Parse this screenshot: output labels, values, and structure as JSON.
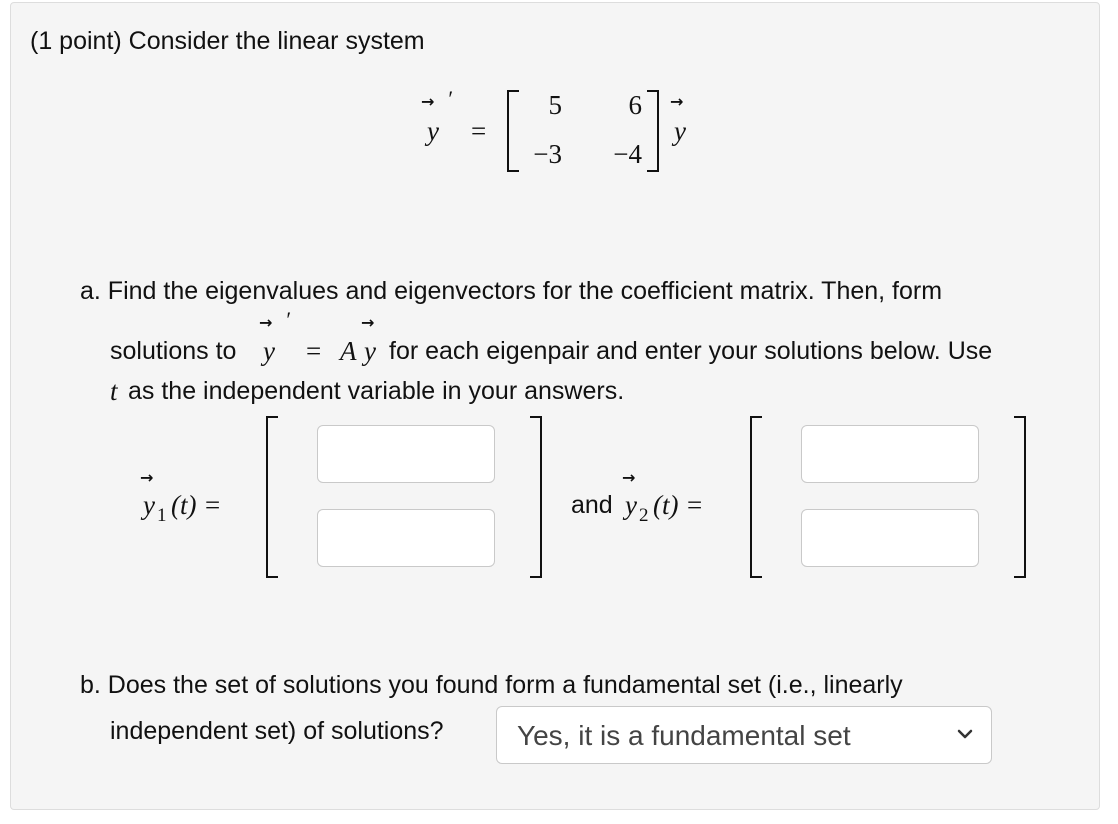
{
  "problem": {
    "intro": "(1 point) Consider the linear system",
    "system": {
      "lhs_var": "y",
      "equals": "=",
      "matrix": [
        [
          "5",
          "6"
        ],
        [
          "−3",
          "−4"
        ]
      ],
      "rhs_var": "y"
    },
    "part_a": {
      "line1": "a. Find the eigenvalues and eigenvectors for the coefficient matrix. Then, form",
      "line2_start": "solutions to",
      "eq_var": "y",
      "eq_equals": "=",
      "eq_rhs_A": "A",
      "eq_rhs_y": "y",
      "line2_end": "for each eigenpair and enter your solutions below. Use",
      "line3_var": "t",
      "line3_rest": "as the independent variable in your answers.",
      "y1_label": "y",
      "y1_sub": "1",
      "y1_arg": "(t) =",
      "and": "and",
      "y2_label": "y",
      "y2_sub": "2",
      "y2_arg": "(t) =",
      "y1_inputs": [
        "",
        ""
      ],
      "y2_inputs": [
        "",
        ""
      ]
    },
    "part_b": {
      "line1": "b. Does the set of solutions you found form a fundamental set (i.e., linearly",
      "line2": "independent set) of solutions?",
      "selected": "Yes, it is a fundamental set"
    }
  },
  "icons": {
    "arrow": "vector-arrow-icon",
    "dropdown": "chevron-down-icon"
  }
}
